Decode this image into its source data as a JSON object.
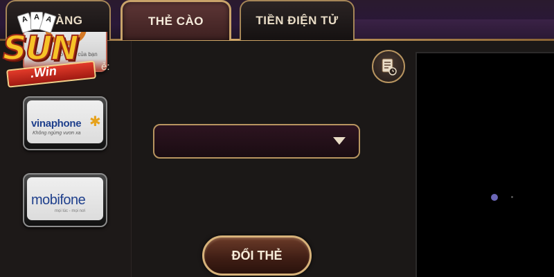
{
  "tabs": [
    {
      "label": "NẠP NGÂN HÀNG",
      "visible_label": "NG         ÀNG",
      "active": false
    },
    {
      "label": "THẺ CÀO",
      "active": true
    },
    {
      "label": "TIỀN ĐIỆN TỬ",
      "active": false
    }
  ],
  "logo": {
    "brand": "SUN",
    "suffix": ".Win",
    "cards": [
      "A",
      "A",
      "A"
    ]
  },
  "carrier_section": {
    "label_fragment": "ẻ:"
  },
  "carriers": [
    {
      "id": "partial-top",
      "slogan": "hãy nói theo cách của bạn"
    },
    {
      "id": "vinaphone",
      "name": "vinaphone",
      "tagline": "Không ngừng vươn xa"
    },
    {
      "id": "mobifone",
      "name": "mobifone",
      "tagline": "mọi lúc - mọi nơi"
    }
  ],
  "form": {
    "dropdown_value": "",
    "submit_label": "ĐỔI THẺ"
  },
  "colors": {
    "gold": "#c9a36a",
    "background": "#1b1817",
    "active_tab": "#5d3636",
    "dot": "#6b66b6"
  },
  "icons": {
    "history": "history-icon",
    "dropdown": "caret-down-icon"
  }
}
